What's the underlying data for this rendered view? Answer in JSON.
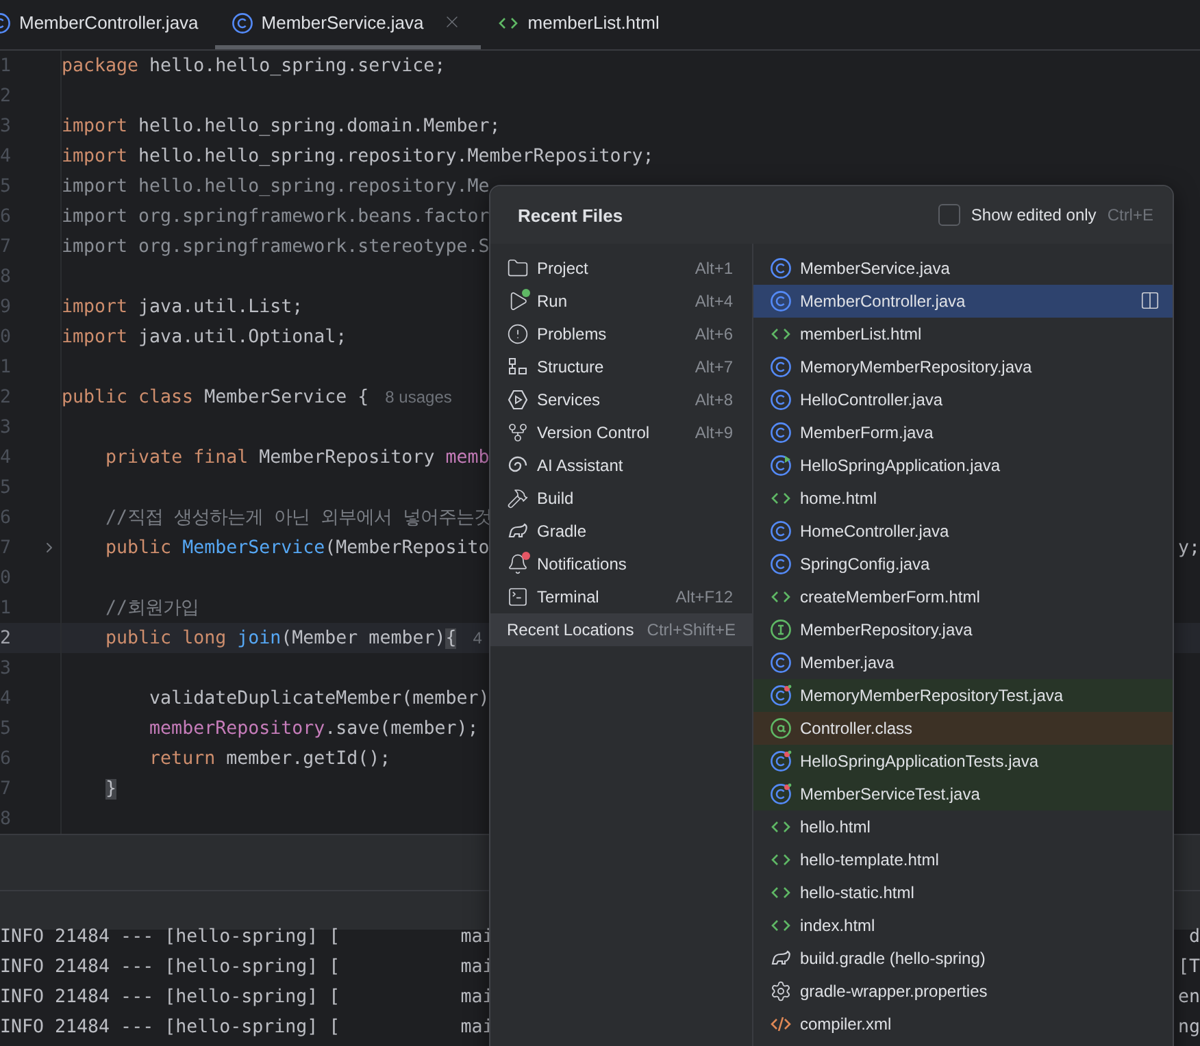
{
  "tabs": [
    {
      "label": "MemberController.java",
      "kind": "class",
      "selected": false
    },
    {
      "label": "MemberService.java",
      "kind": "class",
      "selected": true
    },
    {
      "label": "memberList.html",
      "kind": "html",
      "selected": false
    }
  ],
  "editor": {
    "lines": [
      {
        "number": "1",
        "current": false,
        "folded": false,
        "tokens": [
          {
            "kind": "kw",
            "t": "package "
          },
          {
            "kind": "plain",
            "t": "hello.hello_spring.service;"
          }
        ]
      },
      {
        "number": "2",
        "current": false,
        "folded": false
      },
      {
        "number": "3",
        "current": false,
        "folded": false,
        "tokens": [
          {
            "kind": "kw",
            "t": "import "
          },
          {
            "kind": "plain",
            "t": "hello.hello_spring.domain.Member;"
          }
        ]
      },
      {
        "number": "4",
        "current": false,
        "folded": false,
        "tokens": [
          {
            "kind": "kw",
            "t": "import "
          },
          {
            "kind": "plain",
            "t": "hello.hello_spring.repository.MemberRepository;"
          }
        ]
      },
      {
        "number": "5",
        "current": false,
        "folded": false,
        "tokens": [
          {
            "kind": "dim",
            "t": "import hello.hello_spring.repository.Me"
          }
        ]
      },
      {
        "number": "6",
        "current": false,
        "folded": false,
        "tokens": [
          {
            "kind": "dim",
            "t": "import org.springframework.beans.factor"
          }
        ]
      },
      {
        "number": "7",
        "current": false,
        "folded": false,
        "tokens": [
          {
            "kind": "dim",
            "t": "import org.springframework.stereotype.S"
          }
        ]
      },
      {
        "number": "8",
        "current": false,
        "folded": false
      },
      {
        "number": "9",
        "current": false,
        "folded": false,
        "tokens": [
          {
            "kind": "kw",
            "t": "import "
          },
          {
            "kind": "plain",
            "t": "java.util.List;"
          }
        ]
      },
      {
        "number": "0",
        "current": false,
        "folded": false,
        "tokens": [
          {
            "kind": "kw",
            "t": "import "
          },
          {
            "kind": "plain",
            "t": "java.util.Optional;"
          }
        ]
      },
      {
        "number": "1",
        "current": false,
        "folded": false
      },
      {
        "number": "2",
        "current": false,
        "folded": false,
        "tokens": [
          {
            "kind": "kw",
            "t": "public class "
          },
          {
            "kind": "plain",
            "t": "MemberService {"
          },
          {
            "kind": "hint",
            "t": "8 usages"
          }
        ]
      },
      {
        "number": "3",
        "current": false,
        "folded": false
      },
      {
        "number": "4",
        "current": false,
        "folded": false,
        "tokens": [
          {
            "kind": "kw",
            "t": "    private final "
          },
          {
            "kind": "plain",
            "t": "MemberRepository "
          },
          {
            "kind": "field",
            "t": "memb"
          }
        ]
      },
      {
        "number": "5",
        "current": false,
        "folded": false
      },
      {
        "number": "6",
        "current": false,
        "folded": false,
        "tokens": [
          {
            "kind": "comment",
            "t": "    //직접 생성하는게 아닌 외부에서 넣어주는것"
          }
        ]
      },
      {
        "number": "7",
        "current": false,
        "folded": true,
        "tokens": [
          {
            "kind": "kw",
            "t": "    public "
          },
          {
            "kind": "method",
            "t": "MemberService"
          },
          {
            "kind": "plain",
            "t": "(MemberReposito"
          }
        ],
        "tail": "y;"
      },
      {
        "number": "0",
        "current": false,
        "folded": false
      },
      {
        "number": "1",
        "current": false,
        "folded": false,
        "tokens": [
          {
            "kind": "comment",
            "t": "    //회원가입"
          }
        ]
      },
      {
        "number": "2",
        "current": true,
        "folded": false,
        "tokens": [
          {
            "kind": "kw",
            "t": "    public long "
          },
          {
            "kind": "method",
            "t": "join"
          },
          {
            "kind": "plain",
            "t": "(Member member)"
          },
          {
            "kind": "brace",
            "t": "{"
          },
          {
            "kind": "hint",
            "t": "4"
          }
        ]
      },
      {
        "number": "3",
        "current": false,
        "folded": false
      },
      {
        "number": "4",
        "current": false,
        "folded": false,
        "tokens": [
          {
            "kind": "plain",
            "t": "        validateDuplicateMember(member)"
          }
        ]
      },
      {
        "number": "5",
        "current": false,
        "folded": false,
        "tokens": [
          {
            "kind": "field",
            "t": "        memberRepository"
          },
          {
            "kind": "plain",
            "t": ".save(member);"
          }
        ]
      },
      {
        "number": "6",
        "current": false,
        "folded": false,
        "tokens": [
          {
            "kind": "kw",
            "t": "        return "
          },
          {
            "kind": "plain",
            "t": "member.getId();"
          }
        ]
      },
      {
        "number": "7",
        "current": false,
        "folded": false,
        "tokens": [
          {
            "kind": "brace",
            "t": "    }"
          }
        ]
      },
      {
        "number": "8",
        "current": false,
        "folded": false
      }
    ]
  },
  "console": {
    "lines": [
      {
        "text": "INFO 21484 --- [hello-spring] [           mai",
        "tail": "d"
      },
      {
        "text": "INFO 21484 --- [hello-spring] [           mai",
        "tail": "[T"
      },
      {
        "text": "INFO 21484 --- [hello-spring] [           mai",
        "tail": "en"
      },
      {
        "text": "INFO 21484 --- [hello-spring] [           mai",
        "tail": "ng"
      }
    ]
  },
  "popup": {
    "title": "Recent Files",
    "show_edited_only": {
      "label": "Show edited only",
      "shortcut": "Ctrl+E",
      "checked": false
    },
    "tool_windows": [
      {
        "label": "Project",
        "shortcut": "Alt+1",
        "kind": "folder"
      },
      {
        "label": "Run",
        "shortcut": "Alt+4",
        "kind": "run"
      },
      {
        "label": "Problems",
        "shortcut": "Alt+6",
        "kind": "problems"
      },
      {
        "label": "Structure",
        "shortcut": "Alt+7",
        "kind": "structure"
      },
      {
        "label": "Services",
        "shortcut": "Alt+8",
        "kind": "services"
      },
      {
        "label": "Version Control",
        "shortcut": "Alt+9",
        "kind": "vcs"
      },
      {
        "label": "AI Assistant",
        "kind": "ai"
      },
      {
        "label": "Build",
        "kind": "build"
      },
      {
        "label": "Gradle",
        "kind": "gradle"
      },
      {
        "label": "Notifications",
        "kind": "bell"
      },
      {
        "label": "Terminal",
        "shortcut": "Alt+F12",
        "kind": "terminal"
      }
    ],
    "recent_locations": {
      "label": "Recent Locations",
      "shortcut": "Ctrl+Shift+E"
    },
    "files": [
      {
        "name": "MemberService.java",
        "kind": "class",
        "selected": false
      },
      {
        "name": "MemberController.java",
        "kind": "class",
        "selected": true
      },
      {
        "name": "memberList.html",
        "kind": "html",
        "selected": false
      },
      {
        "name": "MemoryMemberRepository.java",
        "kind": "class",
        "selected": false
      },
      {
        "name": "HelloController.java",
        "kind": "class",
        "selected": false
      },
      {
        "name": "MemberForm.java",
        "kind": "class",
        "selected": false
      },
      {
        "name": "HelloSpringApplication.java",
        "kind": "app",
        "selected": false
      },
      {
        "name": "home.html",
        "kind": "html",
        "selected": false
      },
      {
        "name": "HomeController.java",
        "kind": "class",
        "selected": false
      },
      {
        "name": "SpringConfig.java",
        "kind": "class",
        "selected": false
      },
      {
        "name": "createMemberForm.html",
        "kind": "html",
        "selected": false
      },
      {
        "name": "MemberRepository.java",
        "kind": "interface",
        "selected": false
      },
      {
        "name": "Member.java",
        "kind": "class",
        "selected": false
      },
      {
        "name": "MemoryMemberRepositoryTest.java",
        "kind": "test",
        "selected": false,
        "color": "#283528"
      },
      {
        "name": "Controller.class",
        "kind": "annotation",
        "selected": false,
        "color": "#3c3125"
      },
      {
        "name": "HelloSpringApplicationTests.java",
        "kind": "test",
        "selected": false,
        "color": "#283528"
      },
      {
        "name": "MemberServiceTest.java",
        "kind": "test",
        "selected": false,
        "color": "#283528"
      },
      {
        "name": "hello.html",
        "kind": "html",
        "selected": false
      },
      {
        "name": "hello-template.html",
        "kind": "html",
        "selected": false
      },
      {
        "name": "hello-static.html",
        "kind": "html",
        "selected": false
      },
      {
        "name": "index.html",
        "kind": "html",
        "selected": false
      },
      {
        "name": "build.gradle (hello-spring)",
        "kind": "gradle",
        "selected": false
      },
      {
        "name": "gradle-wrapper.properties",
        "kind": "properties",
        "selected": false
      },
      {
        "name": "compiler.xml",
        "kind": "xml",
        "selected": false
      }
    ]
  }
}
